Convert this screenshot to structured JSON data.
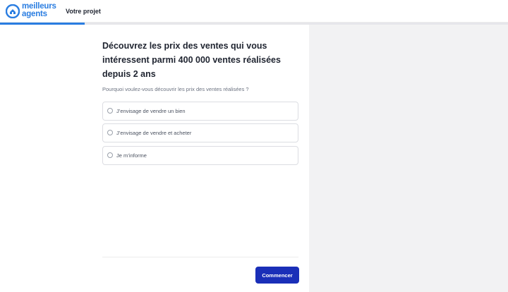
{
  "header": {
    "logo_line1": "meilleurs",
    "logo_line2": "agents",
    "nav_label": "Votre projet"
  },
  "progress": {
    "fraction": 0.167,
    "fill_color": "#2a7de1"
  },
  "question": {
    "title": "Découvrez les prix des ventes qui vous intéressent parmi 400 000 ventes réalisées depuis 2 ans",
    "subtitle": "Pourquoi voulez-vous découvrir les prix des ventes réalisées ?",
    "options": [
      {
        "label": "J’envisage de vendre un bien",
        "selected": false
      },
      {
        "label": "J’envisage de vendre et acheter",
        "selected": false
      },
      {
        "label": "Je m’informe",
        "selected": false
      }
    ]
  },
  "actions": {
    "start_label": "Commencer"
  },
  "colors": {
    "brand": "#2a7de1",
    "cta": "#1a2fb8",
    "panel": "#f2f2f3"
  }
}
